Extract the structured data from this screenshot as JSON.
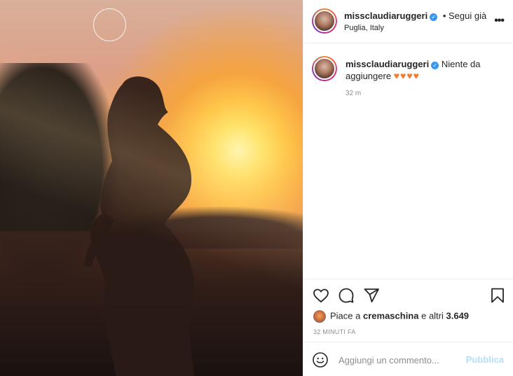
{
  "post": {
    "username": "missclaudiaruggeri",
    "follow_status": "• Segui già",
    "location": "Puglia, Italy",
    "more_glyph": "•••"
  },
  "caption": {
    "username": "missclaudiaruggeri",
    "text": "Niente da aggiungere",
    "hearts": "♥♥♥♥",
    "time": "32 m"
  },
  "likes": {
    "prefix": "Piace a ",
    "user": "cremaschina",
    "suffix": " e altri ",
    "count": "3.649"
  },
  "posted_ago": "32 MINUTI FA",
  "comment": {
    "placeholder": "Aggiungi un commento...",
    "publish_label": "Pubblica"
  },
  "colors": {
    "verified": "#3897f0",
    "publish_disabled": "#b2dffc",
    "hearts": "#f07a2e"
  },
  "icons": [
    "verified-badge-icon",
    "more-options-icon",
    "like-heart-icon",
    "comment-icon",
    "share-icon",
    "save-bookmark-icon",
    "emoji-icon"
  ]
}
